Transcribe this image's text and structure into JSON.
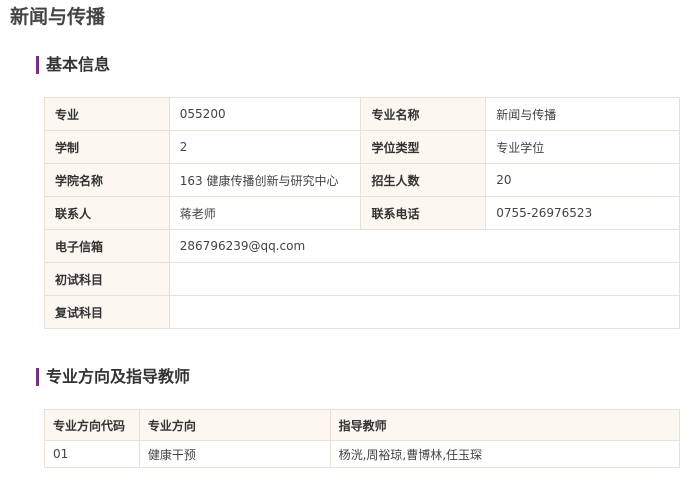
{
  "page": {
    "title": "新闻与传播"
  },
  "basic_info": {
    "heading": "基本信息",
    "rows": [
      {
        "l1": "专业",
        "v1": "055200",
        "l2": "专业名称",
        "v2": "新闻与传播"
      },
      {
        "l1": "学制",
        "v1": "2",
        "l2": "学位类型",
        "v2": "专业学位"
      },
      {
        "l1": "学院名称",
        "v1": "163 健康传播创新与研究中心",
        "l2": "招生人数",
        "v2": "20"
      },
      {
        "l1": "联系人",
        "v1": "蒋老师",
        "l2": "联系电话",
        "v2": "0755-26976523"
      }
    ],
    "email_label": "电子信箱",
    "email_value": "286796239@qq.com",
    "initial_label": "初试科目",
    "initial_value": "",
    "retest_label": "复试科目",
    "retest_value": ""
  },
  "directions": {
    "heading": "专业方向及指导教师",
    "columns": [
      "专业方向代码",
      "专业方向",
      "指导教师"
    ],
    "rows": [
      {
        "code": "01",
        "direction": "健康干预",
        "advisors": "杨洸,周裕琼,曹博林,任玉琛"
      }
    ]
  },
  "colors": {
    "accent": "#7a2f8f",
    "label_bg": "#fcf8f1",
    "border": "#e8e0d4"
  }
}
